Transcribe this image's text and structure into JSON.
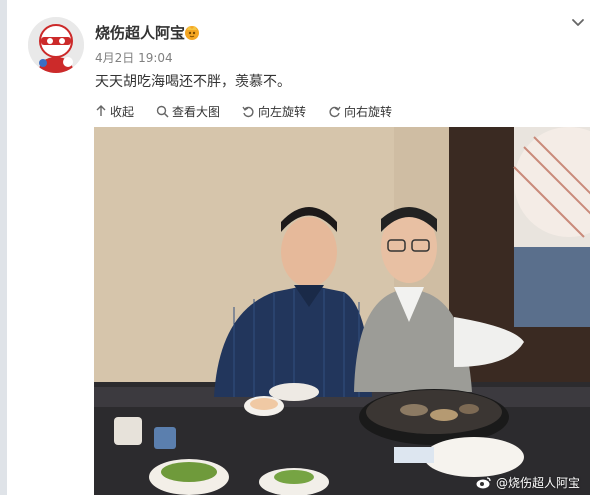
{
  "post": {
    "author": "烧伤超人阿宝",
    "time": "4月2日 19:04",
    "text": "天天胡吃海喝还不胖，羡慕不。"
  },
  "toolbar": {
    "collapse_label": "收起",
    "view_large_label": "查看大图",
    "rotate_left_label": "向左旋转",
    "rotate_right_label": "向右旋转"
  },
  "photo": {
    "watermark": "@烧伤超人阿宝"
  },
  "colors": {
    "text": "#333333",
    "muted": "#808080",
    "badge": "#f5a623",
    "page_bg": "#dfe3e8"
  },
  "icons": [
    "chevron-down-icon",
    "vip-badge-icon",
    "collapse-arrow-icon",
    "magnifier-icon",
    "rotate-left-icon",
    "rotate-right-icon",
    "weibo-logo-icon"
  ]
}
